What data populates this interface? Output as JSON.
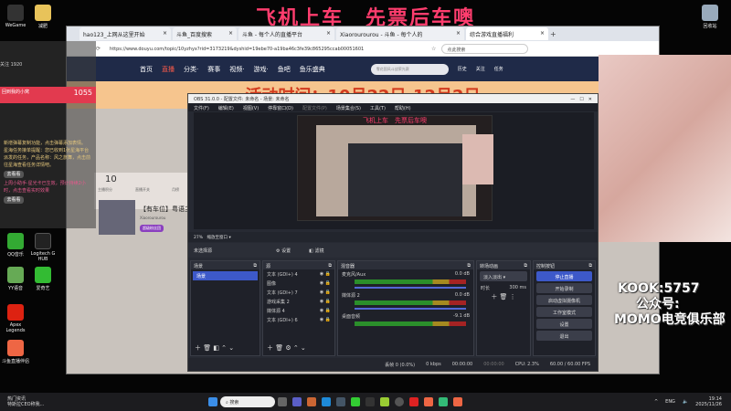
{
  "banner": "飞机上车　先票后车噢",
  "desktop": {
    "icons": [
      "WeGame",
      "减肥",
      "回收站",
      "斗鱼直播伴侣",
      "QQ音乐",
      "Logitech G HUB",
      "YY语音",
      "爱奇艺",
      "Apex Legends",
      "斗鱼直播伴侣"
    ]
  },
  "browser": {
    "tabs": [
      {
        "label": "hao123_上网从这里开始"
      },
      {
        "label": "斗鱼_百度搜索"
      },
      {
        "label": "斗鱼 - 每个人的直播平台"
      },
      {
        "label": "Xiaorourourou - 斗鱼 - 每个人的"
      },
      {
        "label": "综合游戏直播福利"
      }
    ],
    "url": "https://www.douyu.com/topic/10yzhyx?rid=3173219&dyshid=19ebe70-a19ba46c3fe39c865295ccab00051601",
    "search_placeholder": "点此搜索",
    "nav": [
      "首页",
      "直播",
      "分类·",
      "赛事",
      "视频·",
      "游戏·",
      "鱼吧",
      "鱼乐盛典"
    ],
    "site_search_placeholder": "零花国风斗战荣光赛",
    "nav_right": [
      "历史",
      "关注",
      "任务"
    ],
    "hero": "活动时间：10月22日-12月2日",
    "follow": "关注 1920",
    "score": "10",
    "score_label": "主播积分",
    "toggle_label": "直播开关",
    "rank_label": "月榜",
    "stream_title": "【有车位】粤语主",
    "streamer": "Xiaorourourou",
    "badge": "超级粉丝团"
  },
  "obs": {
    "title": "OBS 31.0.0 - 配置文件: 未命名 - 场景: 未命名",
    "menu": [
      "文件(F)",
      "编辑(E)",
      "视图(V)",
      "停靠窗口(D)",
      "配置文件(P)",
      "场景集合(S)",
      "工具(T)",
      "帮助(H)"
    ],
    "preview_banner": "飞机上车　先票后车噢",
    "zoom": "27%",
    "preview_mode": "缩放至窗口",
    "no_source": "未选择源",
    "settings_btn": "设置",
    "filters_btn": "滤镜",
    "docks": {
      "scenes": "场景",
      "sources": "源",
      "mixer": "混音器",
      "transitions": "转场动画",
      "controls": "控制按钮"
    },
    "scenes": [
      "场景"
    ],
    "sources": [
      "文本 (GDI+) 4",
      "图像",
      "文本 (GDI+) 7",
      "游戏采集 2",
      "媒体源 4",
      "文本 (GDI+) 6"
    ],
    "mixer": [
      {
        "name": "麦克风/Aux",
        "db": "0.0 dB"
      },
      {
        "name": "媒体源 2",
        "db": "0.0 dB"
      },
      {
        "name": "桌面音频",
        "db": "-9.1 dB"
      }
    ],
    "transition": "淡入淡出",
    "duration_label": "时长",
    "duration": "300 ms",
    "controls": [
      "停止直播",
      "开始录制",
      "启动虚拟摄像机",
      "工作室模式",
      "设置",
      "退出"
    ],
    "status": {
      "dropped": "丢帧 0 (0.0%)",
      "bitrate": "0 kbps",
      "stream_time": "00:00:00",
      "rec_time": "00:00:00",
      "cpu": "CPU: 2.3%",
      "fps": "60.00 / 60.00 FPS"
    }
  },
  "overlay": {
    "kook": "KOOK:5757",
    "gzh": "公众号:",
    "club": "MOMO电竞俱乐部"
  },
  "chat": {
    "user": "回到我的小窝",
    "gift": "1055",
    "msgs": [
      "新增弹幕复制功能，点击弹幕添加表情。",
      "星海任务接单提醒：您已收到1张星海平台派发的任务，产品名称：风之旅舞，点击前往星海查看任务详情吧。",
      "去看看",
      "上周小助手·星光卡已生效，预计持续2小时，点击查看实时效果",
      "去看看"
    ]
  },
  "taskbar": {
    "news_title": "热门资讯",
    "news_sub": "特斯拉CEO称我...",
    "search": "搜索",
    "lang": "ENG",
    "time": "19:14",
    "date": "2025/11/26"
  }
}
